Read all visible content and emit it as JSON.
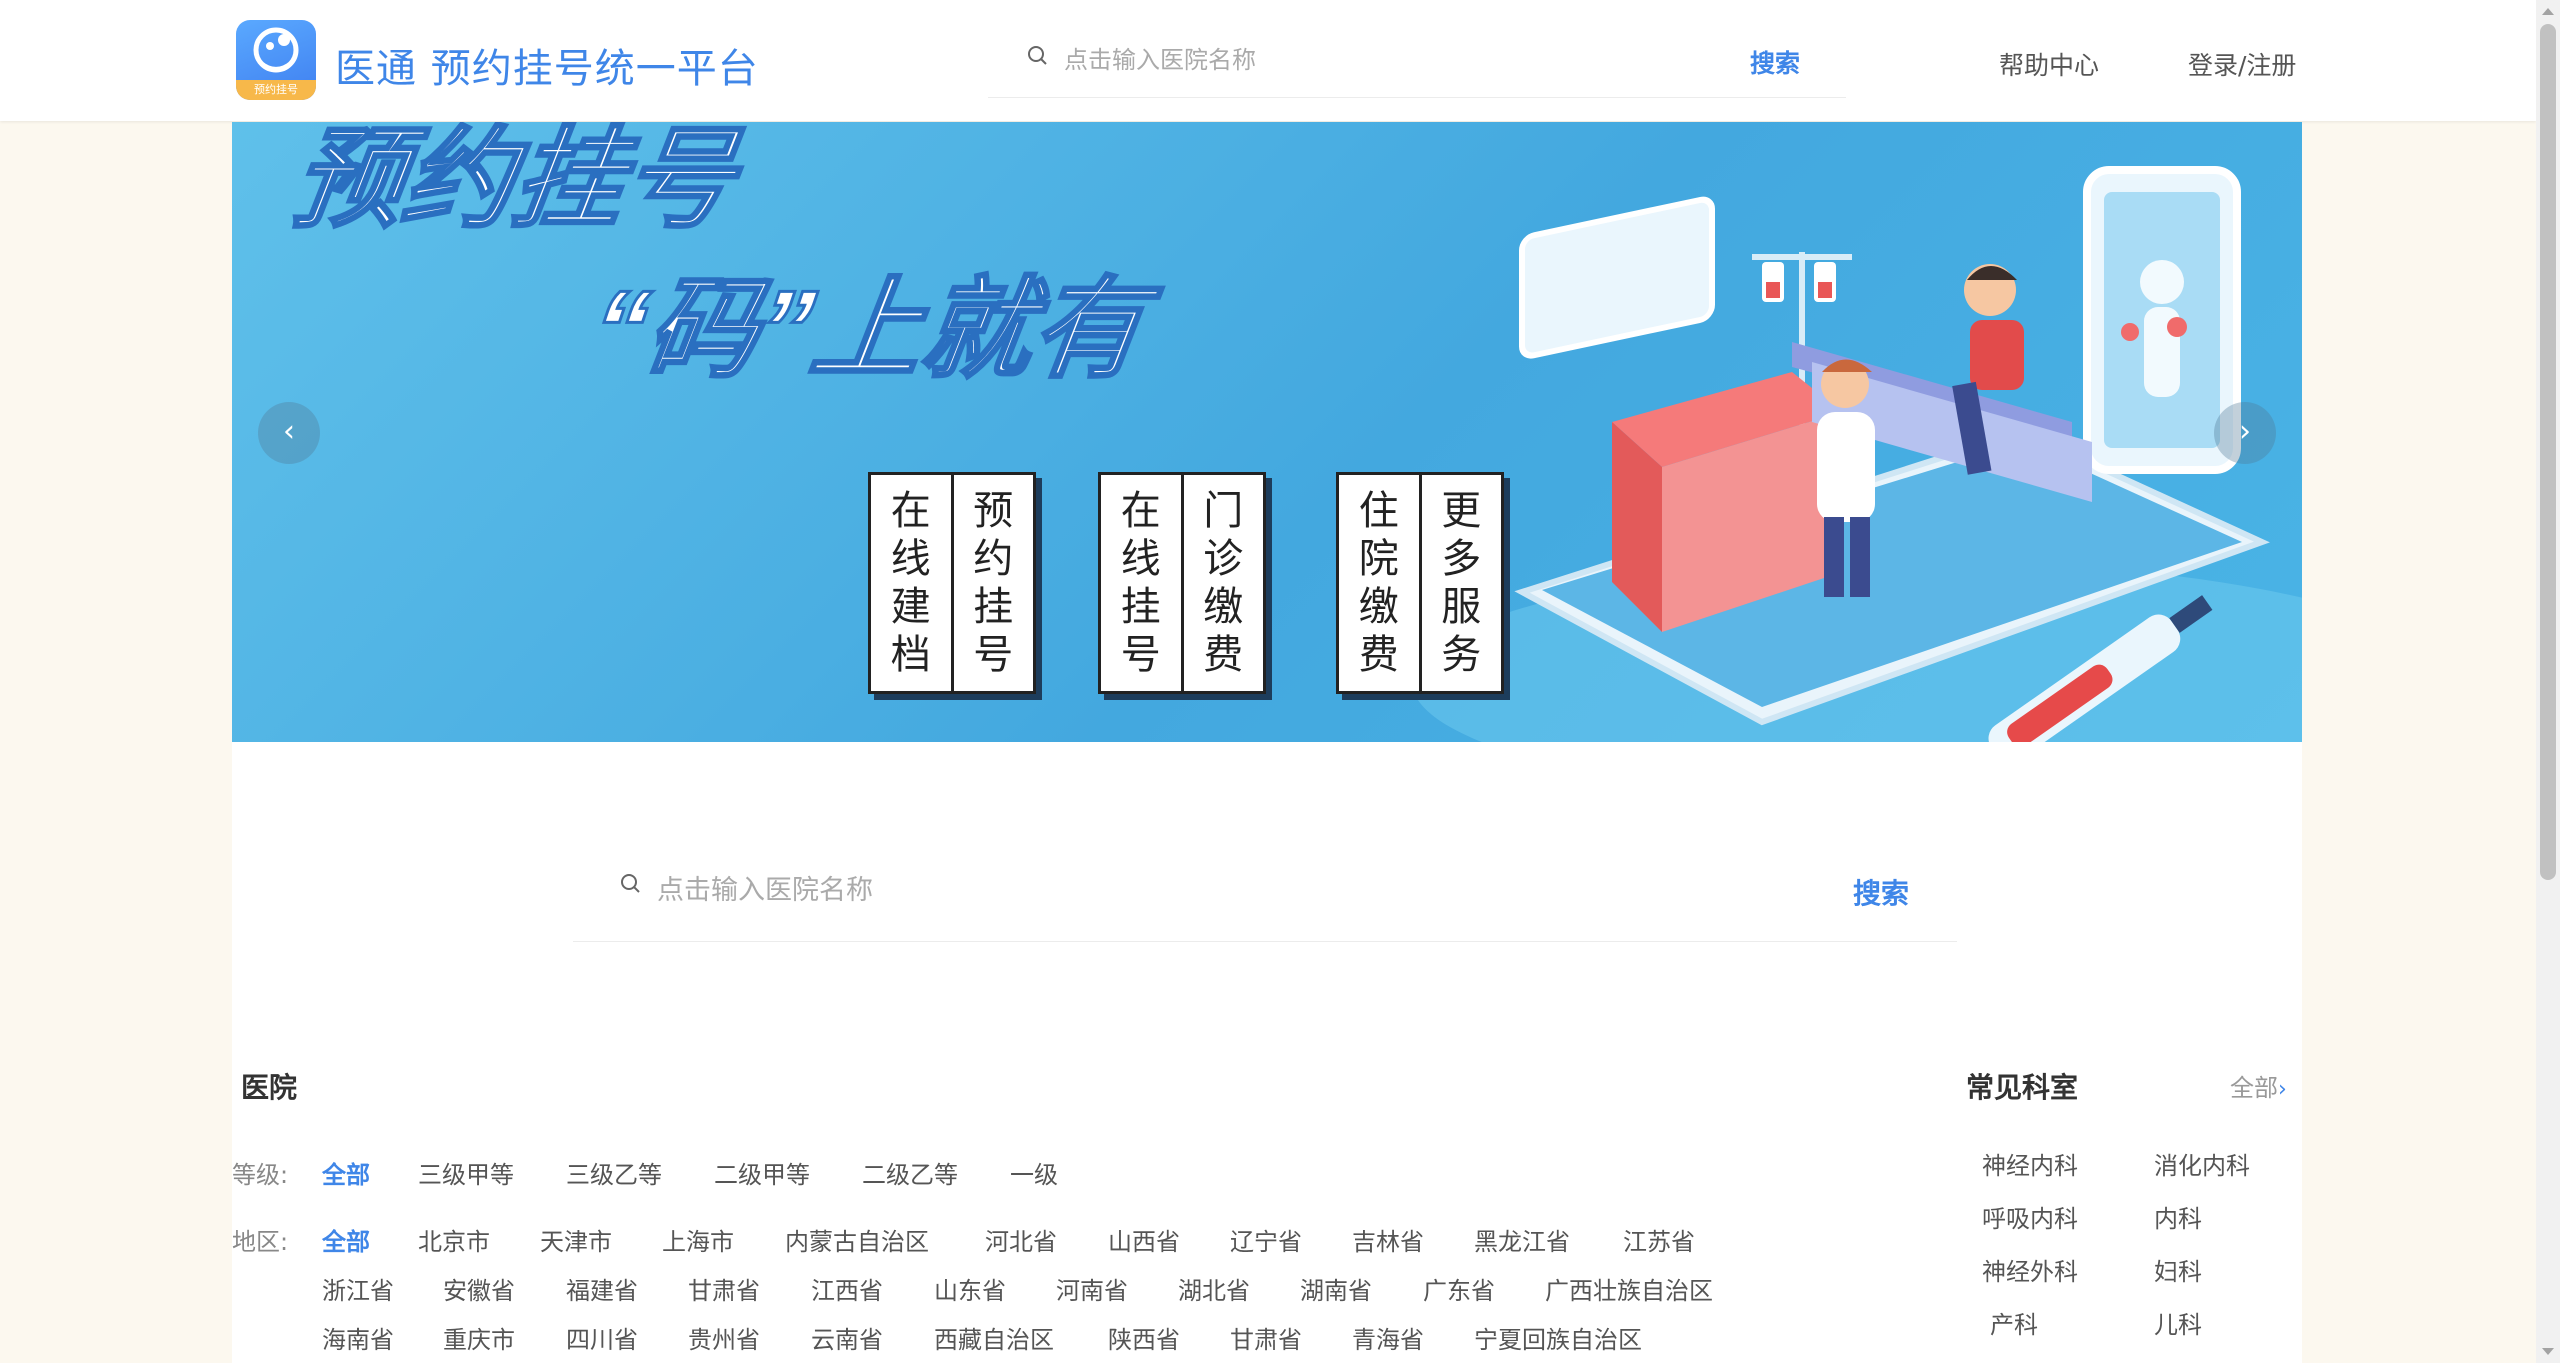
{
  "header": {
    "site_title": "医通 预约挂号统一平台",
    "logo_strip": "预约挂号",
    "search_placeholder": "点击输入医院名称",
    "search_button": "搜索",
    "help": "帮助中心",
    "login": "登录/注册"
  },
  "banner": {
    "headline_1": "预约挂号",
    "headline_2": "“码”上就有",
    "cards": [
      {
        "left": "在线建档",
        "right": "预约挂号"
      },
      {
        "left": "在线挂号",
        "right": "门诊缴费"
      },
      {
        "left": "住院缴费",
        "right": "更多服务"
      }
    ],
    "prev": "‹",
    "next": "›",
    "active_slide": 3,
    "slide_count": 3
  },
  "main_search": {
    "placeholder": "点击输入医院名称",
    "button": "搜索"
  },
  "hospital_section": {
    "title": "医院",
    "level_label": "等级:",
    "levels": [
      "全部",
      "三级甲等",
      "三级乙等",
      "二级甲等",
      "二级乙等",
      "一级"
    ],
    "region_label": "地区:",
    "regions_row1": [
      "全部",
      "北京市",
      "天津市",
      "上海市",
      "内蒙古自治区",
      "河北省",
      "山西省",
      "辽宁省",
      "吉林省",
      "黑龙江省",
      "江苏省"
    ],
    "regions_row2": [
      "浙江省",
      "安徽省",
      "福建省",
      "甘肃省",
      "江西省",
      "山东省",
      "河南省",
      "湖北省",
      "湖南省",
      "广东省",
      "广西壮族自治区"
    ],
    "regions_row3": [
      "海南省",
      "重庆市",
      "四川省",
      "贵州省",
      "云南省",
      "西藏自治区",
      "陕西省",
      "甘肃省",
      "青海省",
      "宁夏回族自治区"
    ]
  },
  "departments": {
    "title": "常见科室",
    "all": "全部",
    "items": [
      "神经内科",
      "消化内科",
      "呼吸内科",
      "内科",
      "神经外科",
      "妇科",
      "产科",
      "儿科"
    ]
  },
  "colors": {
    "accent": "#3f86e8",
    "background": "#fcf8ef",
    "banner": "#4ab4e6"
  }
}
